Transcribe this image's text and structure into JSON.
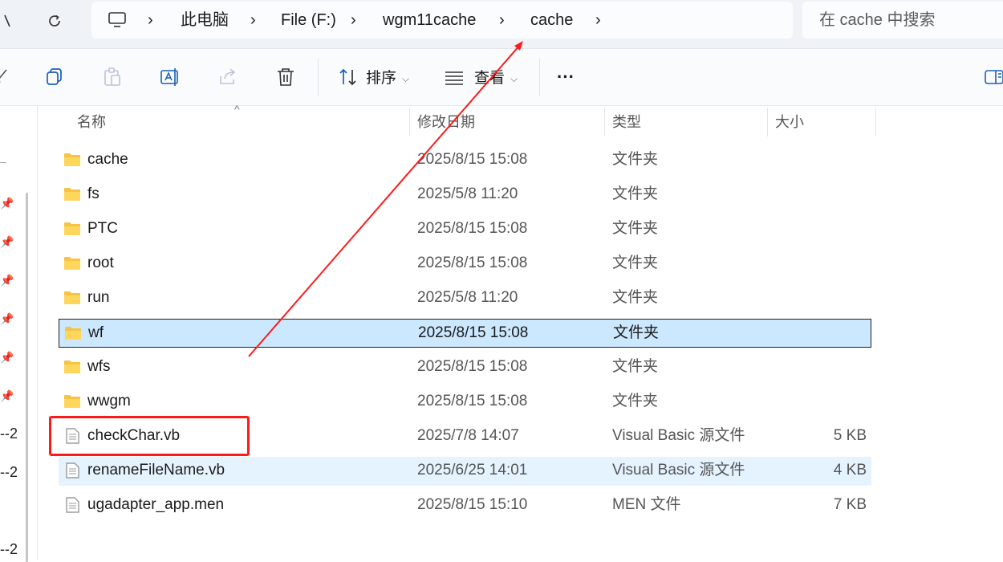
{
  "address": {
    "breadcrumbs": [
      "此电脑",
      "File (F:)",
      "wgm11cache",
      "cache"
    ]
  },
  "search": {
    "placeholder": "在 cache 中搜索"
  },
  "toolbar": {
    "sort_label": "排序",
    "view_label": "查看",
    "more_label": "···"
  },
  "columns": {
    "name": "名称",
    "date": "修改日期",
    "type": "类型",
    "size": "大小"
  },
  "leftpane": {
    "fragments": [
      "--2",
      "--2",
      "--2"
    ]
  },
  "files": [
    {
      "name": "cache",
      "date": "2025/8/15 15:08",
      "type": "文件夹",
      "size": "",
      "kind": "folder",
      "state": ""
    },
    {
      "name": "fs",
      "date": "2025/5/8 11:20",
      "type": "文件夹",
      "size": "",
      "kind": "folder",
      "state": ""
    },
    {
      "name": "PTC",
      "date": "2025/8/15 15:08",
      "type": "文件夹",
      "size": "",
      "kind": "folder",
      "state": ""
    },
    {
      "name": "root",
      "date": "2025/8/15 15:08",
      "type": "文件夹",
      "size": "",
      "kind": "folder",
      "state": ""
    },
    {
      "name": "run",
      "date": "2025/5/8 11:20",
      "type": "文件夹",
      "size": "",
      "kind": "folder",
      "state": ""
    },
    {
      "name": "wf",
      "date": "2025/8/15 15:08",
      "type": "文件夹",
      "size": "",
      "kind": "folder",
      "state": "selected"
    },
    {
      "name": "wfs",
      "date": "2025/8/15 15:08",
      "type": "文件夹",
      "size": "",
      "kind": "folder",
      "state": ""
    },
    {
      "name": "wwgm",
      "date": "2025/8/15 15:08",
      "type": "文件夹",
      "size": "",
      "kind": "folder",
      "state": ""
    },
    {
      "name": "checkChar.vb",
      "date": "2025/7/8 14:07",
      "type": "Visual Basic 源文件",
      "size": "5 KB",
      "kind": "file",
      "state": ""
    },
    {
      "name": "renameFileName.vb",
      "date": "2025/6/25 14:01",
      "type": "Visual Basic 源文件",
      "size": "4 KB",
      "kind": "file",
      "state": "hover"
    },
    {
      "name": "ugadapter_app.men",
      "date": "2025/8/15 15:10",
      "type": "MEN 文件",
      "size": "7 KB",
      "kind": "file",
      "state": ""
    }
  ],
  "colors": {
    "annotation": "#ff1a1a",
    "selection_bg": "#cce8ff",
    "hover_bg": "#e5f3ff",
    "folder": "#f6c443"
  },
  "icons": [
    "back-icon",
    "refresh-icon",
    "computer-icon",
    "cut-icon",
    "copy-icon",
    "paste-icon",
    "rename-icon",
    "share-icon",
    "delete-icon",
    "sort-icon",
    "view-icon",
    "more-icon",
    "details-pane-icon",
    "folder-icon",
    "file-icon",
    "pin-icon"
  ]
}
